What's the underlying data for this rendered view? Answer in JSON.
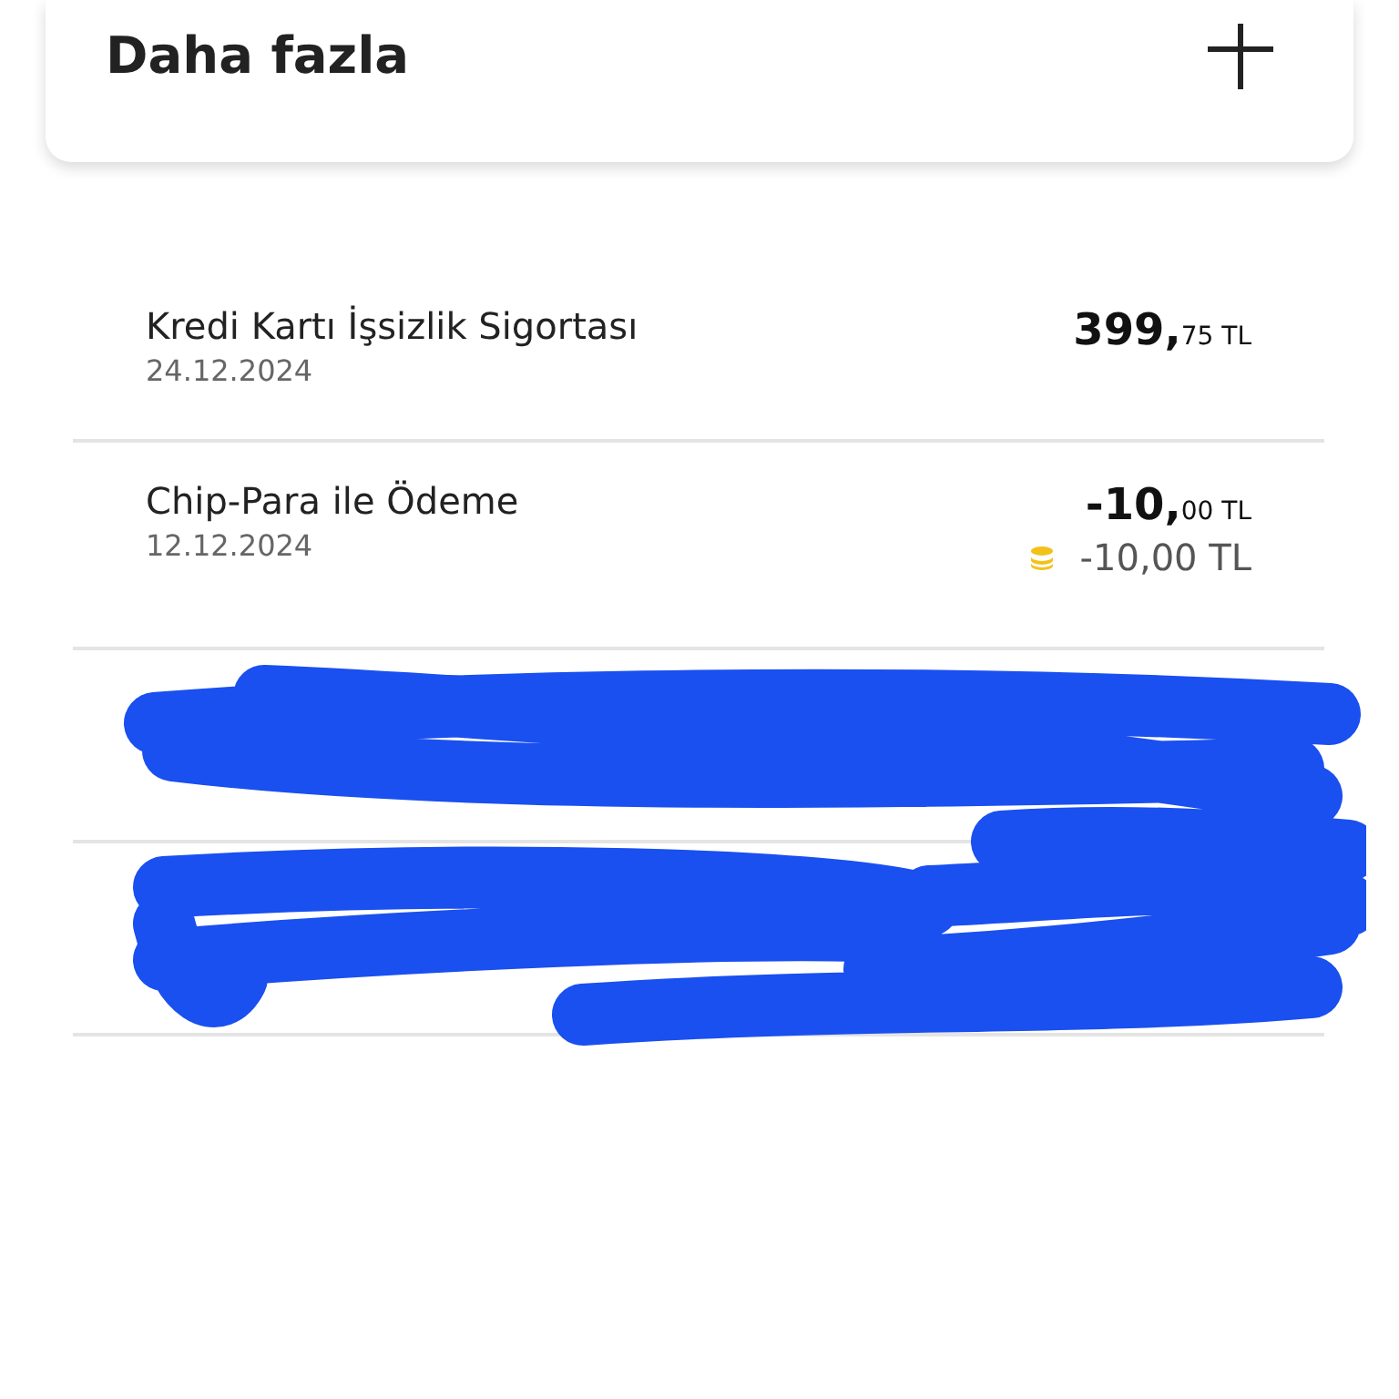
{
  "card": {
    "title": "Daha fazla"
  },
  "transactions": [
    {
      "kind": "transaction",
      "title": "Kredi Kartı İşsizlik Sigortası",
      "date": "24.12.2024",
      "whole": "399,",
      "fraction": "75 TL"
    },
    {
      "kind": "transaction",
      "title": "Chip-Para ile Ödeme",
      "date": "12.12.2024",
      "whole": "-10,",
      "fraction": "00 TL",
      "chip_para": "-10,00 TL"
    },
    {
      "kind": "redacted"
    },
    {
      "kind": "redacted"
    }
  ]
}
